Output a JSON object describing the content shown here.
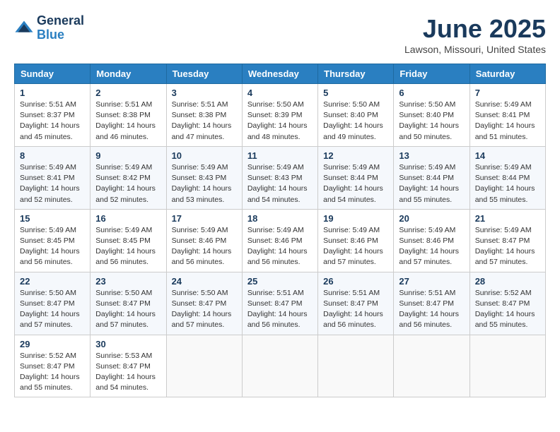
{
  "logo": {
    "general": "General",
    "blue": "Blue"
  },
  "title": "June 2025",
  "location": "Lawson, Missouri, United States",
  "weekdays": [
    "Sunday",
    "Monday",
    "Tuesday",
    "Wednesday",
    "Thursday",
    "Friday",
    "Saturday"
  ],
  "weeks": [
    [
      {
        "day": "1",
        "sunrise": "5:51 AM",
        "sunset": "8:37 PM",
        "daylight": "14 hours and 45 minutes."
      },
      {
        "day": "2",
        "sunrise": "5:51 AM",
        "sunset": "8:38 PM",
        "daylight": "14 hours and 46 minutes."
      },
      {
        "day": "3",
        "sunrise": "5:51 AM",
        "sunset": "8:38 PM",
        "daylight": "14 hours and 47 minutes."
      },
      {
        "day": "4",
        "sunrise": "5:50 AM",
        "sunset": "8:39 PM",
        "daylight": "14 hours and 48 minutes."
      },
      {
        "day": "5",
        "sunrise": "5:50 AM",
        "sunset": "8:40 PM",
        "daylight": "14 hours and 49 minutes."
      },
      {
        "day": "6",
        "sunrise": "5:50 AM",
        "sunset": "8:40 PM",
        "daylight": "14 hours and 50 minutes."
      },
      {
        "day": "7",
        "sunrise": "5:49 AM",
        "sunset": "8:41 PM",
        "daylight": "14 hours and 51 minutes."
      }
    ],
    [
      {
        "day": "8",
        "sunrise": "5:49 AM",
        "sunset": "8:41 PM",
        "daylight": "14 hours and 52 minutes."
      },
      {
        "day": "9",
        "sunrise": "5:49 AM",
        "sunset": "8:42 PM",
        "daylight": "14 hours and 52 minutes."
      },
      {
        "day": "10",
        "sunrise": "5:49 AM",
        "sunset": "8:43 PM",
        "daylight": "14 hours and 53 minutes."
      },
      {
        "day": "11",
        "sunrise": "5:49 AM",
        "sunset": "8:43 PM",
        "daylight": "14 hours and 54 minutes."
      },
      {
        "day": "12",
        "sunrise": "5:49 AM",
        "sunset": "8:44 PM",
        "daylight": "14 hours and 54 minutes."
      },
      {
        "day": "13",
        "sunrise": "5:49 AM",
        "sunset": "8:44 PM",
        "daylight": "14 hours and 55 minutes."
      },
      {
        "day": "14",
        "sunrise": "5:49 AM",
        "sunset": "8:44 PM",
        "daylight": "14 hours and 55 minutes."
      }
    ],
    [
      {
        "day": "15",
        "sunrise": "5:49 AM",
        "sunset": "8:45 PM",
        "daylight": "14 hours and 56 minutes."
      },
      {
        "day": "16",
        "sunrise": "5:49 AM",
        "sunset": "8:45 PM",
        "daylight": "14 hours and 56 minutes."
      },
      {
        "day": "17",
        "sunrise": "5:49 AM",
        "sunset": "8:46 PM",
        "daylight": "14 hours and 56 minutes."
      },
      {
        "day": "18",
        "sunrise": "5:49 AM",
        "sunset": "8:46 PM",
        "daylight": "14 hours and 56 minutes."
      },
      {
        "day": "19",
        "sunrise": "5:49 AM",
        "sunset": "8:46 PM",
        "daylight": "14 hours and 57 minutes."
      },
      {
        "day": "20",
        "sunrise": "5:49 AM",
        "sunset": "8:46 PM",
        "daylight": "14 hours and 57 minutes."
      },
      {
        "day": "21",
        "sunrise": "5:49 AM",
        "sunset": "8:47 PM",
        "daylight": "14 hours and 57 minutes."
      }
    ],
    [
      {
        "day": "22",
        "sunrise": "5:50 AM",
        "sunset": "8:47 PM",
        "daylight": "14 hours and 57 minutes."
      },
      {
        "day": "23",
        "sunrise": "5:50 AM",
        "sunset": "8:47 PM",
        "daylight": "14 hours and 57 minutes."
      },
      {
        "day": "24",
        "sunrise": "5:50 AM",
        "sunset": "8:47 PM",
        "daylight": "14 hours and 57 minutes."
      },
      {
        "day": "25",
        "sunrise": "5:51 AM",
        "sunset": "8:47 PM",
        "daylight": "14 hours and 56 minutes."
      },
      {
        "day": "26",
        "sunrise": "5:51 AM",
        "sunset": "8:47 PM",
        "daylight": "14 hours and 56 minutes."
      },
      {
        "day": "27",
        "sunrise": "5:51 AM",
        "sunset": "8:47 PM",
        "daylight": "14 hours and 56 minutes."
      },
      {
        "day": "28",
        "sunrise": "5:52 AM",
        "sunset": "8:47 PM",
        "daylight": "14 hours and 55 minutes."
      }
    ],
    [
      {
        "day": "29",
        "sunrise": "5:52 AM",
        "sunset": "8:47 PM",
        "daylight": "14 hours and 55 minutes."
      },
      {
        "day": "30",
        "sunrise": "5:53 AM",
        "sunset": "8:47 PM",
        "daylight": "14 hours and 54 minutes."
      },
      null,
      null,
      null,
      null,
      null
    ]
  ]
}
